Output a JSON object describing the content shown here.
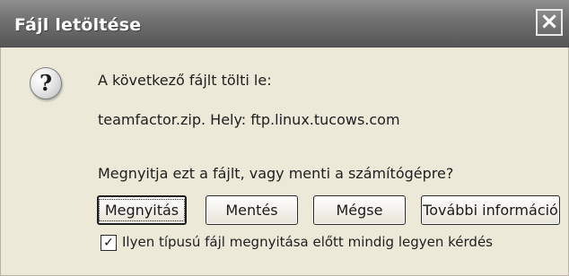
{
  "window": {
    "title": "Fájl letöltése"
  },
  "dialog": {
    "icon": "question-icon",
    "icon_glyph": "?",
    "line1": "A következő fájlt tölti le:",
    "file_info": "teamfactor.zip. Hely: ftp.linux.tucows.com",
    "question": "Megnyitja ezt a fájlt, vagy menti a számítógépre?"
  },
  "buttons": {
    "open": "Megnyitás",
    "save": "Mentés",
    "cancel": "Mégse",
    "more_info": "További információ"
  },
  "checkbox": {
    "checked": true,
    "label": "Ilyen típusú fájl megnyitása előtt mindig legyen kérdés"
  },
  "close_glyph": "×"
}
